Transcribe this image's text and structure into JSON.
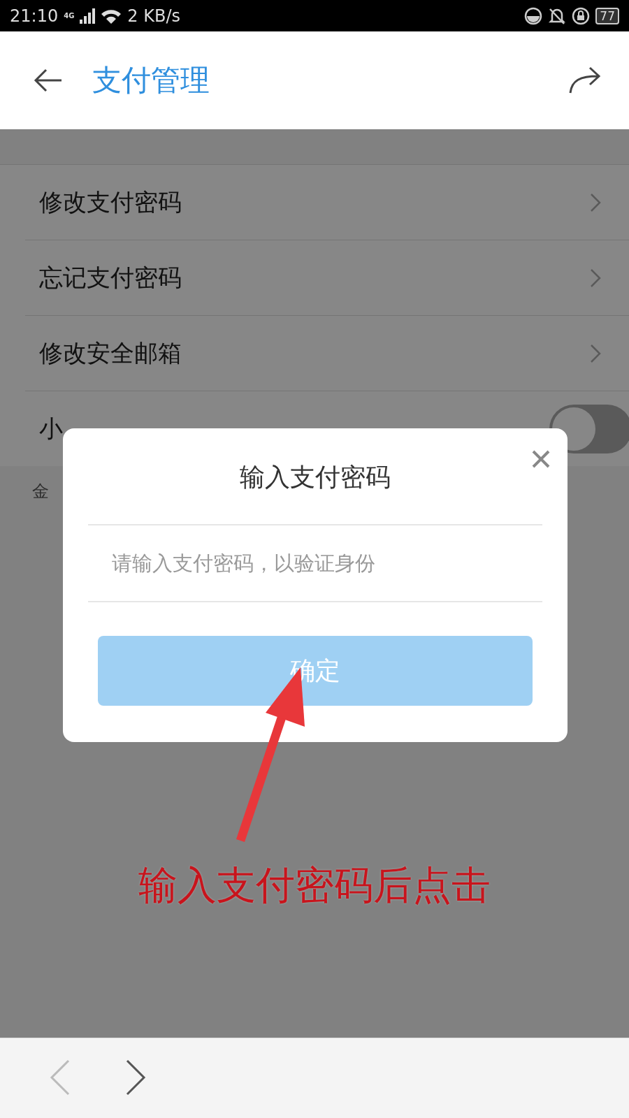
{
  "status_bar": {
    "time": "21:10",
    "network": "4G",
    "speed": "2 KB/s",
    "battery": "77"
  },
  "header": {
    "title": "支付管理"
  },
  "settings": [
    {
      "kind": "link",
      "label": "修改支付密码"
    },
    {
      "kind": "link",
      "label": "忘记支付密码"
    },
    {
      "kind": "link",
      "label": "修改安全邮箱"
    },
    {
      "kind": "toggle",
      "label": "小",
      "on": false
    }
  ],
  "note": "金",
  "dialog": {
    "title": "输入支付密码",
    "password_field": {
      "placeholder": "请输入支付密码，以验证身份"
    },
    "confirm_button": "确定"
  },
  "annotation": {
    "text": "输入支付密码后点击"
  },
  "bottom_nav": {
    "back_disabled": true,
    "forward_disabled": false
  }
}
